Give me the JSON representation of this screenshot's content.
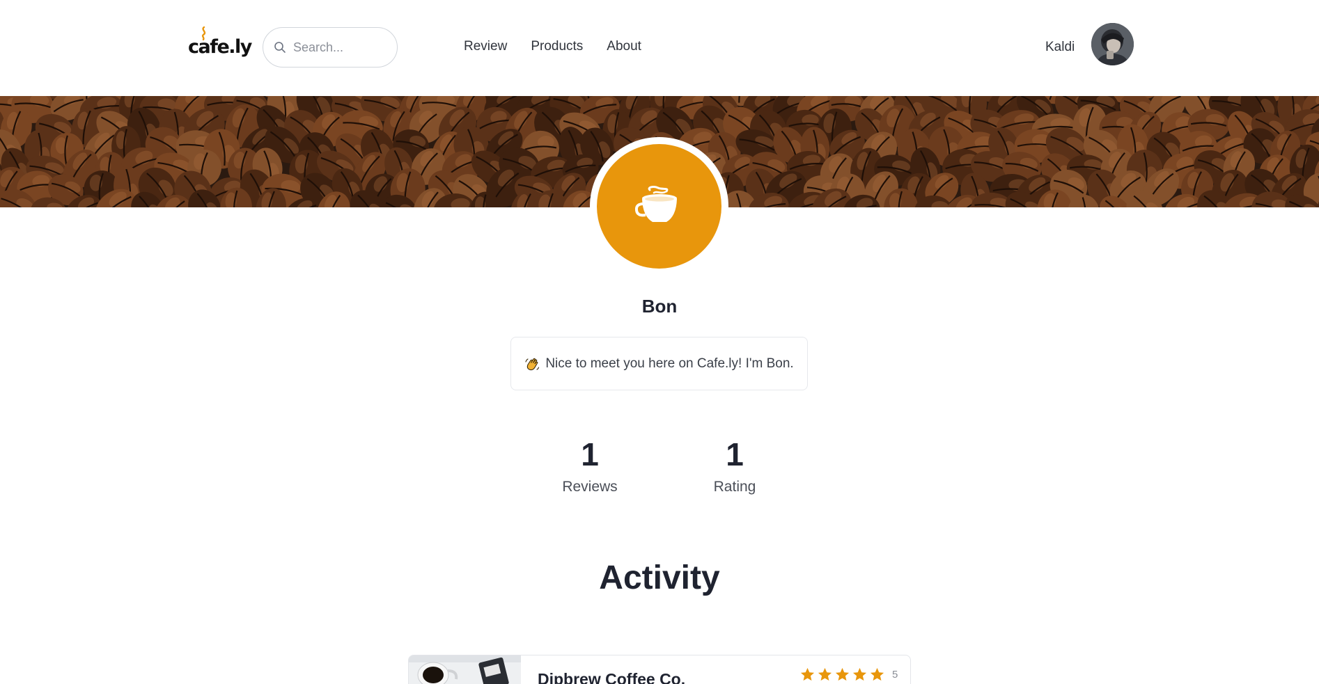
{
  "nav": {
    "logo_text": "cafe.ly",
    "search_placeholder": "Search...",
    "links": [
      "Review",
      "Products",
      "About"
    ],
    "user_name": "Kaldi"
  },
  "profile": {
    "name": "Bon",
    "bio": "Nice to meet you here on Cafe.ly! I'm Bon.",
    "stats": [
      {
        "value": "1",
        "label": "Reviews"
      },
      {
        "value": "1",
        "label": "Rating"
      }
    ]
  },
  "activity": {
    "title": "Activity",
    "items": [
      {
        "title": "Dipbrew Coffee Co.",
        "stars": 5,
        "score": "5"
      }
    ]
  },
  "colors": {
    "accent": "#e8960c",
    "text_dark": "#1f2330",
    "banner": "#2b1a10"
  },
  "icons": {
    "search": "search-icon",
    "avatar_placeholder": "coffee-cup-icon",
    "bio": "waving-hand-icon",
    "rating": "star-icon"
  }
}
